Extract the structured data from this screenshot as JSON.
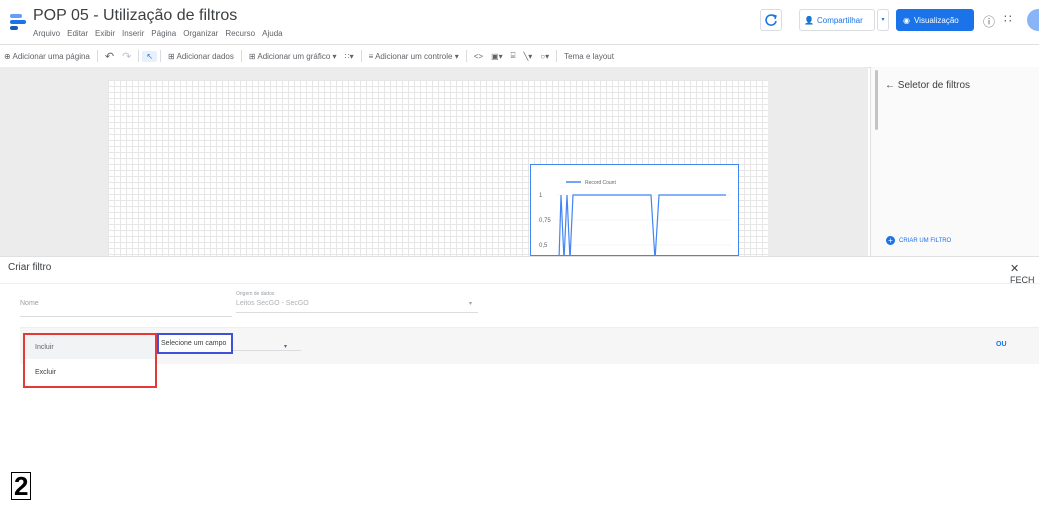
{
  "header": {
    "title": "POP 05 - Utilização de filtros",
    "menu": [
      "Arquivo",
      "Editar",
      "Exibir",
      "Inserir",
      "Página",
      "Organizar",
      "Recurso",
      "Ajuda"
    ],
    "share_label": "Compartilhar",
    "view_label": "Visualização"
  },
  "toolbar": {
    "add_page": "Adicionar uma página",
    "add_data": "Adicionar dados",
    "add_chart": "Adicionar um gráfico",
    "add_control": "Adicionar um controle",
    "theme": "Tema e layout"
  },
  "chart_data": {
    "type": "line",
    "series": [
      {
        "name": "Record Count"
      }
    ],
    "y_ticks": [
      "1",
      "0,75",
      "0,5"
    ],
    "ylim": [
      0.5,
      1
    ]
  },
  "right_panel": {
    "title": "Seletor de filtros",
    "create_filter": "CRIAR UM FILTRO"
  },
  "dialog": {
    "title": "Criar filtro",
    "close_label": "FECH",
    "name_placeholder": "Nome",
    "datasource_label": "Origem de dados",
    "datasource_value": "Leitos SecGO - SecGO",
    "options": [
      "Incluir",
      "Excluir"
    ],
    "field_placeholder": "Selecione um campo",
    "or_label": "OU"
  },
  "step_label": "2",
  "colors": {
    "accent": "#1a73e8",
    "highlight_red": "#e53935",
    "highlight_blue": "#3f51d9"
  }
}
